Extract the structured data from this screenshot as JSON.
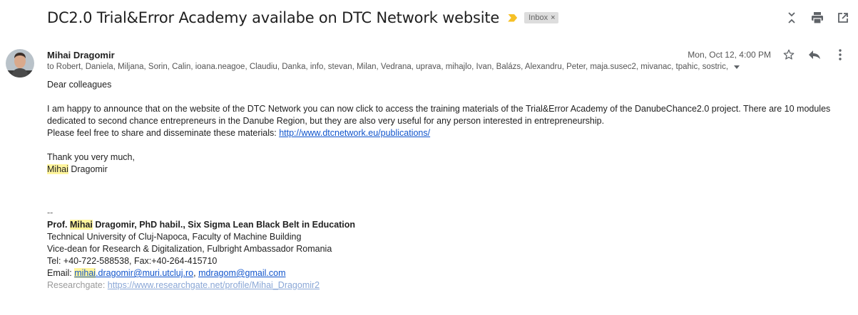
{
  "subject": "DC2.0 Trial&Error Academy availabe on DTC Network website",
  "label": {
    "name": "Inbox",
    "close": "×"
  },
  "toolbar_icons": [
    "expand-collapse-icon",
    "print-icon",
    "open-in-new-window-icon"
  ],
  "colors": {
    "importance": "#f6c026",
    "link": "#1155cc",
    "highlight": "#fff59d"
  },
  "sender": {
    "name": "Mihai Dragomir",
    "date": "Mon, Oct 12, 4:00 PM",
    "recipients": "to Robert, Daniela, Miljana, Sorin, Calin, ioana.neagoe, Claudiu, Danka, info, stevan, Milan, Vedrana, uprava, mihajlo, Ivan, Balázs, Alexandru, Peter, maja.susec2, mivanac, tpahic, sostric,"
  },
  "header_icons": [
    "star-icon",
    "reply-icon",
    "more-vert-icon"
  ],
  "body": {
    "greeting": "Dear colleagues",
    "paragraph1": "I am happy to announce that on the website of the DTC Network you can now click to access the training materials of the Trial&Error Academy of the DanubeChance2.0 project. There are 10 modules dedicated to second chance entrepreneurs in the Danube Region, but they are also very useful for any person interested in entrepreneurship.",
    "share_text": "Please feel free to share and disseminate these materials: ",
    "share_link": "http://www.dtcnetwork.eu/publications/",
    "thanks": "Thank you very much,",
    "sign_first": "Mihai",
    "sign_last": " Dragomir"
  },
  "signature": {
    "dash": "--",
    "prefix": "Prof. ",
    "first": "Mihai",
    "title_rest": " Dragomir, PhD habil., Six Sigma Lean Black Belt in Education",
    "line1": "Technical University of Cluj-Napoca, Faculty of Machine Building",
    "line2": "Vice-dean for Research & Digitalization, Fulbright Ambassador Romania",
    "line3": "Tel: +40-722-588538, Fax:+40-264-415710",
    "email_label": "Email: ",
    "email1_first": "mihai",
    "email1_rest": ".dragomir@muri.utcluj.ro",
    "email_sep": ", ",
    "email2": "mdragom@gmail.com",
    "rg_label": "Researchgate: ",
    "rg_link": "https://www.researchgate.net/profile/Mihai_Dragomir2"
  }
}
